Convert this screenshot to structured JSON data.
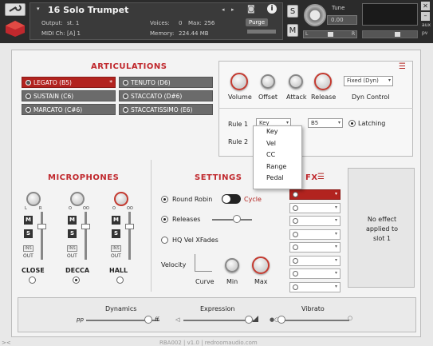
{
  "header": {
    "title": "16 Solo Trumpet",
    "output_label": "Output:",
    "output_value": "st. 1",
    "midi_label": "MIDI Ch:",
    "midi_value": "[A] 1",
    "voices_label": "Voices:",
    "voices_value": "0",
    "max_label": "Max:",
    "max_value": "256",
    "memory_label": "Memory:",
    "memory_value": "224.44 MB",
    "purge_label": "Purge",
    "s_button": "S",
    "m_button": "M",
    "tune_label": "Tune",
    "tune_value": "0.00",
    "pan_label": "L",
    "pan_right": "R",
    "aux_label": "aux",
    "pv_label": "pv"
  },
  "articulations": {
    "title": "ARTICULATIONS",
    "items": [
      {
        "label": "LEGATO (B5)",
        "selected": true
      },
      {
        "label": "TENUTO (D6)",
        "selected": false
      },
      {
        "label": "SUSTAIN (C6)",
        "selected": false
      },
      {
        "label": "STACCATO (D#6)",
        "selected": false
      },
      {
        "label": "MARCATO (C#6)",
        "selected": false
      },
      {
        "label": "STACCATISSIMO (E6)",
        "selected": false
      }
    ],
    "star": "*"
  },
  "envelope": {
    "volume": "Volume",
    "offset": "Offset",
    "attack": "Attack",
    "release": "Release",
    "dyn_control": "Dyn Control",
    "dyn_dropdown": "Fixed (Dyn)"
  },
  "rules": {
    "rule1": "Rule 1",
    "rule2": "Rule 2",
    "rule1_type": "Key",
    "rule1_value": "B5",
    "latching": "Latching",
    "popup_options": [
      "Key",
      "Vel",
      "CC",
      "Range",
      "Pedal"
    ]
  },
  "microphones": {
    "title": "MICROPHONES",
    "channels": [
      {
        "name": "CLOSE",
        "pan_l": "L",
        "pan_r": "R",
        "selected": false
      },
      {
        "name": "DECCA",
        "pan_l": "O",
        "pan_r": "OO",
        "selected": true
      },
      {
        "name": "HALL",
        "pan_l": "O",
        "pan_r": "OO",
        "selected": false
      }
    ],
    "m_label": "M",
    "s_label": "S",
    "ins_label": "INS",
    "out_label": "OUT"
  },
  "settings": {
    "title": "SETTINGS",
    "round_robin": "Round Robin",
    "cycle": "Cycle",
    "releases": "Releases",
    "hq_vel": "HQ Vel XFades",
    "velocity": "Velocity",
    "curve": "Curve",
    "min": "Min",
    "max": "Max"
  },
  "fx": {
    "title": "FX",
    "slot_count": 8,
    "no_effect": "No effect applied to slot 1"
  },
  "bottom": {
    "dynamics": "Dynamics",
    "dynamics_left": "pp",
    "dynamics_right": "ff",
    "expression": "Expression",
    "vibrato": "Vibrato"
  },
  "footer": "RBA002 | v1.0 | redroomaudio.com",
  "colors": {
    "accent": "#b2231f",
    "header": "#2b2b2b"
  }
}
